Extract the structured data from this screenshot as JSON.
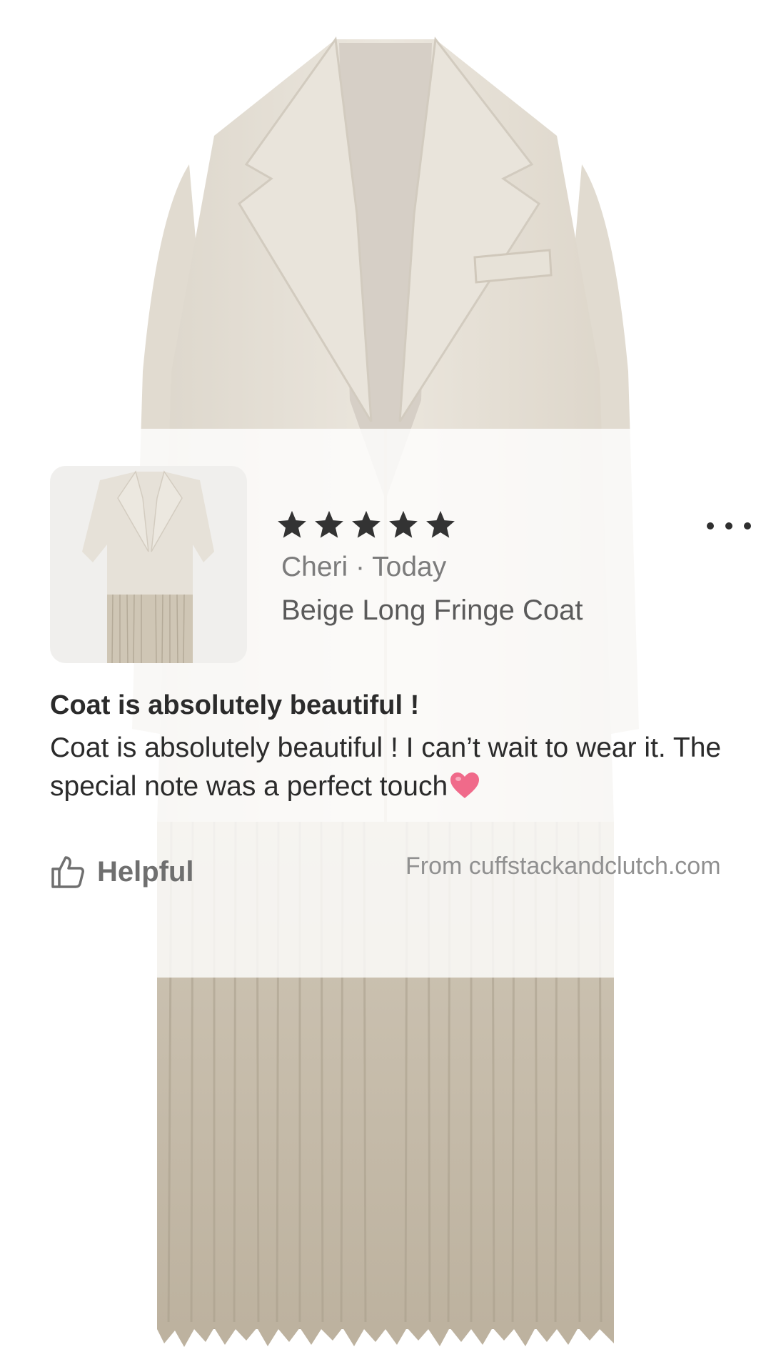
{
  "review": {
    "rating": 5,
    "author_line": "Cheri · Today",
    "product_name": "Beige Long Fringe Coat",
    "title": "Coat is absolutely beautiful !",
    "body": "Coat is absolutely beautiful ! I can’t wait to wear it. The special note was a perfect touch",
    "helpful_label": "Helpful",
    "source": "From cuffstackandclutch.com"
  },
  "icons": {
    "stars": "star-icon",
    "more": "more-options-icon",
    "helpful": "thumbs-up-icon",
    "heart": "pink-heart-emoji"
  },
  "colors": {
    "coat": "#e8e3da",
    "fringe_lower": "#c7bead",
    "star": "#333333",
    "heart": "#f06a8a"
  }
}
